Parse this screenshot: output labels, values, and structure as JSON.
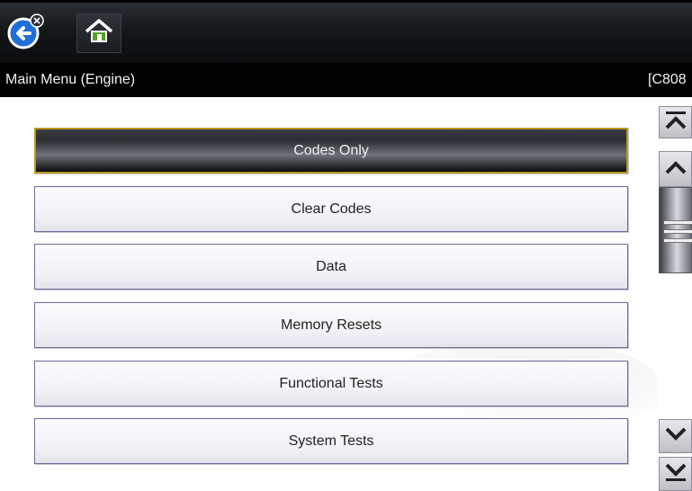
{
  "toolbar": {
    "back_icon": "back-arrow-icon",
    "home_icon": "home-icon"
  },
  "titlebar": {
    "title": "Main Menu (Engine)",
    "code": "[C808"
  },
  "menu": {
    "items": [
      {
        "label": "Codes Only",
        "selected": true
      },
      {
        "label": "Clear Codes",
        "selected": false
      },
      {
        "label": "Data",
        "selected": false
      },
      {
        "label": "Memory Resets",
        "selected": false
      },
      {
        "label": "Functional Tests",
        "selected": false
      },
      {
        "label": "System Tests",
        "selected": false
      }
    ]
  },
  "scrollbar": {
    "icons": [
      "page-up-icon",
      "scroll-up-icon",
      "scroll-down-icon",
      "page-down-icon"
    ]
  },
  "colors": {
    "accent_blue": "#1f6fd6",
    "home_green": "#5aa02c",
    "selected_border": "#b69a1c",
    "item_border": "#6e6a9c"
  }
}
